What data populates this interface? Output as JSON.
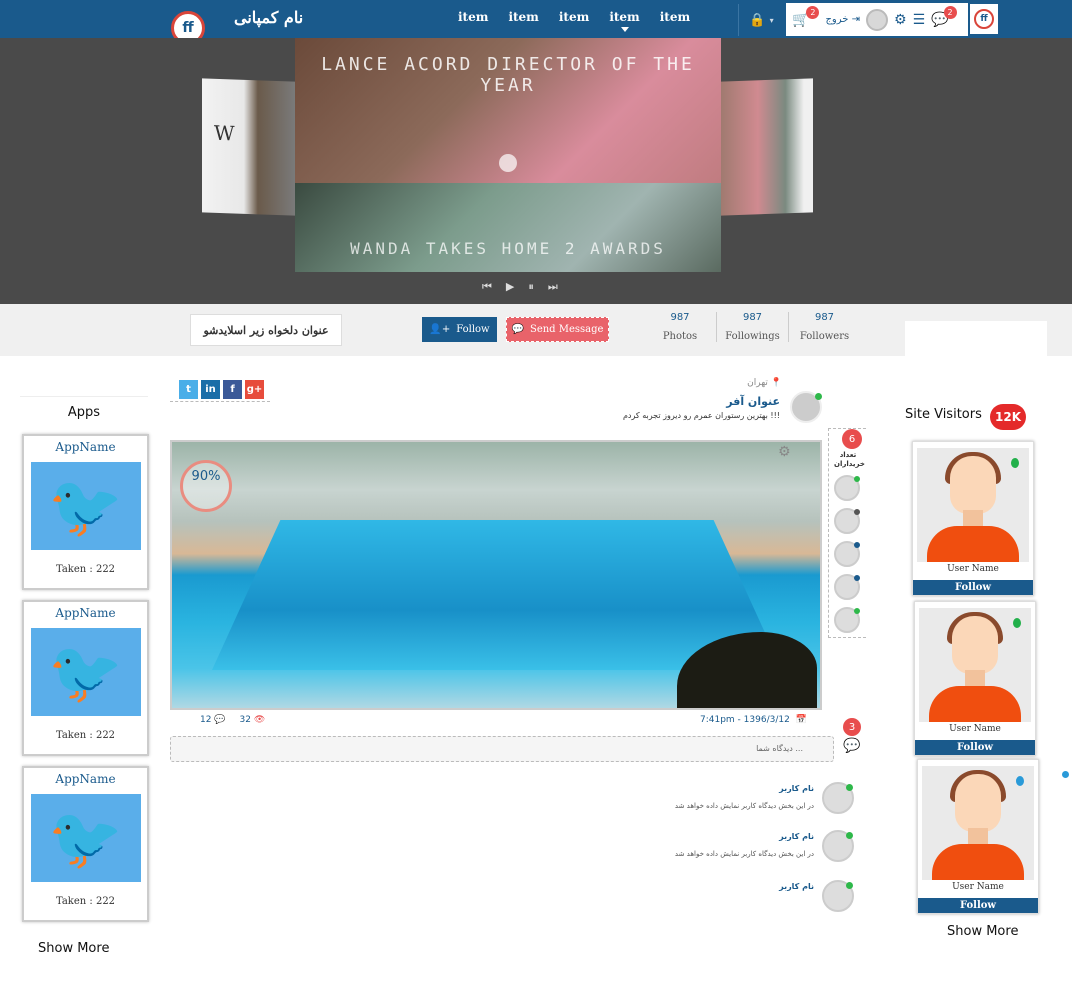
{
  "header": {
    "company_name": "نام کمپانی",
    "logo_text": "ff",
    "menu": [
      "item",
      "item",
      "item",
      "item",
      "item"
    ],
    "active_index": 3,
    "cart_count": "2",
    "exit_label": "خروج",
    "chat_count": "2"
  },
  "hero": {
    "main_caption": "LANCE ACORD DIRECTOR OF THE YEAR",
    "second_caption": "WANDA TAKES HOME 2 AWARDS",
    "side_letter": "W"
  },
  "profile": {
    "title": "عنوان دلخواه زیر اسلایدشو",
    "follow_label": "Follow",
    "send_message_label": "Send Message",
    "stats": [
      {
        "num": "987",
        "label": "Photos"
      },
      {
        "num": "987",
        "label": "Followings"
      },
      {
        "num": "987",
        "label": "Followers"
      }
    ]
  },
  "apps": {
    "title": "Apps",
    "items": [
      {
        "name": "AppName",
        "taken": "Taken : 222"
      },
      {
        "name": "AppName",
        "taken": "Taken : 222"
      },
      {
        "name": "AppName",
        "taken": "Taken : 222"
      }
    ],
    "show_more": "Show More"
  },
  "visitors": {
    "title": "Site Visitors",
    "count": "12K",
    "items": [
      {
        "name": "User Name",
        "follow": "Follow"
      },
      {
        "name": "User Name",
        "follow": "Follow"
      },
      {
        "name": "User Name",
        "follow": "Follow"
      }
    ],
    "show_more": "Show More"
  },
  "post": {
    "social": [
      "t",
      "in",
      "f",
      "g+"
    ],
    "social_colors": [
      "#4aaee8",
      "#1a6ea8",
      "#3b5998",
      "#e74c3c"
    ],
    "location": "تهران",
    "title": "عنوان آفر",
    "description": "بهترین رستوران عمرم رو دیروز تجربه کردم !!!",
    "percent": "90%",
    "buyers_count": "6",
    "buyers_label": "تعداد خریداران",
    "comments_count_small": "12",
    "views": "32",
    "datetime": "7:41pm - 1396/3/12",
    "comments_count": "3",
    "comment_placeholder": "دیدگاه شما ...",
    "comments": [
      {
        "name": "نام کاربر",
        "text": "در این بخش دیدگاه کاربر نمایش داده خواهد شد"
      },
      {
        "name": "نام کاربر",
        "text": "در این بخش دیدگاه کاربر نمایش داده خواهد شد"
      },
      {
        "name": "نام کاربر",
        "text": ""
      }
    ]
  }
}
